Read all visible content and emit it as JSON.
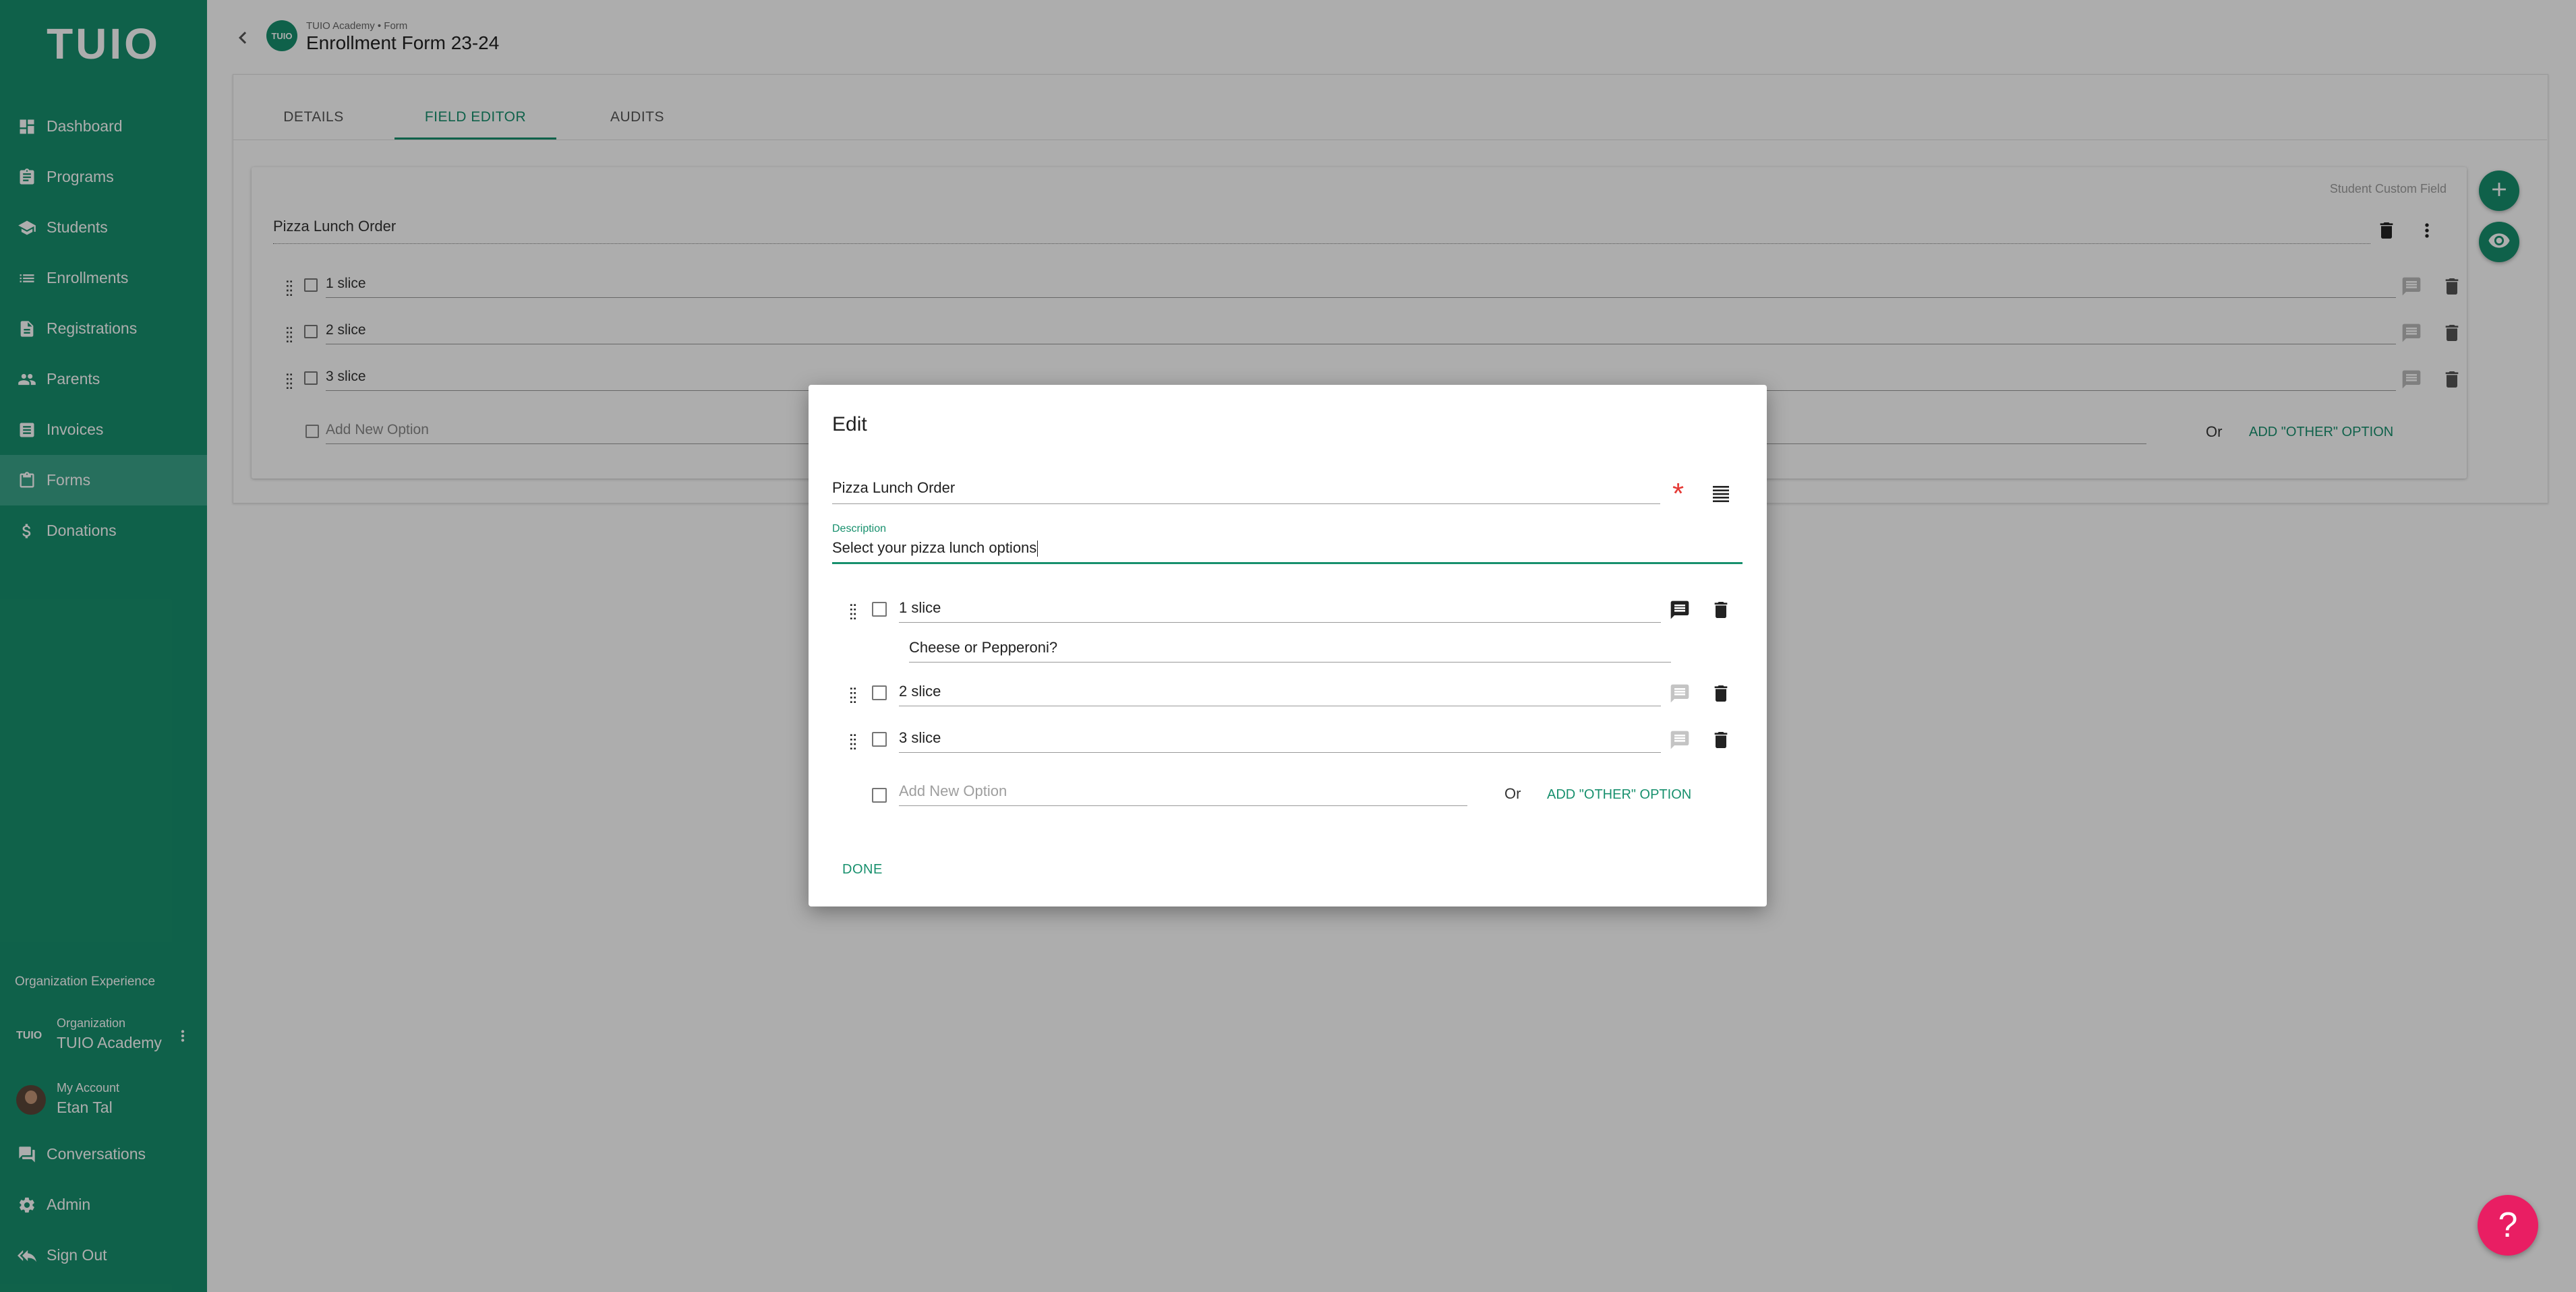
{
  "colors": {
    "brand": "#17906d",
    "danger": "#e53935",
    "help": "#e91e63"
  },
  "sidebar": {
    "logo": "TUIO",
    "items": [
      {
        "label": "Dashboard",
        "icon": "dashboard-icon"
      },
      {
        "label": "Programs",
        "icon": "clipboard-icon"
      },
      {
        "label": "Students",
        "icon": "school-icon"
      },
      {
        "label": "Enrollments",
        "icon": "list-icon"
      },
      {
        "label": "Registrations",
        "icon": "document-icon"
      },
      {
        "label": "Parents",
        "icon": "people-icon"
      },
      {
        "label": "Invoices",
        "icon": "receipt-icon"
      },
      {
        "label": "Forms",
        "icon": "assignment-icon",
        "active": true
      },
      {
        "label": "Donations",
        "icon": "dollar-icon"
      }
    ],
    "org_experience": "Organization Experience",
    "organization": {
      "logo": "TUIO",
      "label": "Organization",
      "name": "TUIO Academy"
    },
    "account": {
      "label": "My Account",
      "name": "Etan Tal"
    },
    "bottom_items": [
      {
        "label": "Conversations",
        "icon": "chat-icon"
      },
      {
        "label": "Admin",
        "icon": "gear-icon"
      },
      {
        "label": "Sign Out",
        "icon": "sign-out-icon"
      }
    ]
  },
  "header": {
    "logo": "TUIO",
    "breadcrumb": "TUIO Academy • Form",
    "title": "Enrollment Form 23-24"
  },
  "tabs": [
    {
      "label": "DETAILS"
    },
    {
      "label": "FIELD EDITOR",
      "active": true
    },
    {
      "label": "AUDITS"
    }
  ],
  "field_card": {
    "tag": "Student Custom Field",
    "title": "Pizza Lunch Order",
    "options": [
      "1 slice",
      "2 slice",
      "3 slice"
    ],
    "add_placeholder": "Add New Option",
    "or": "Or",
    "add_other": "ADD \"OTHER\" OPTION"
  },
  "dialog": {
    "title": "Edit",
    "field_title": "Pizza Lunch Order",
    "description_label": "Description",
    "description": "Select your pizza lunch options",
    "options": [
      {
        "label": "1 slice",
        "comment": "Cheese or Pepperoni?"
      },
      {
        "label": "2 slice"
      },
      {
        "label": "3 slice"
      }
    ],
    "add_placeholder": "Add New Option",
    "or": "Or",
    "add_other": "ADD \"OTHER\" OPTION",
    "done": "DONE"
  },
  "help": {
    "label": "?"
  }
}
